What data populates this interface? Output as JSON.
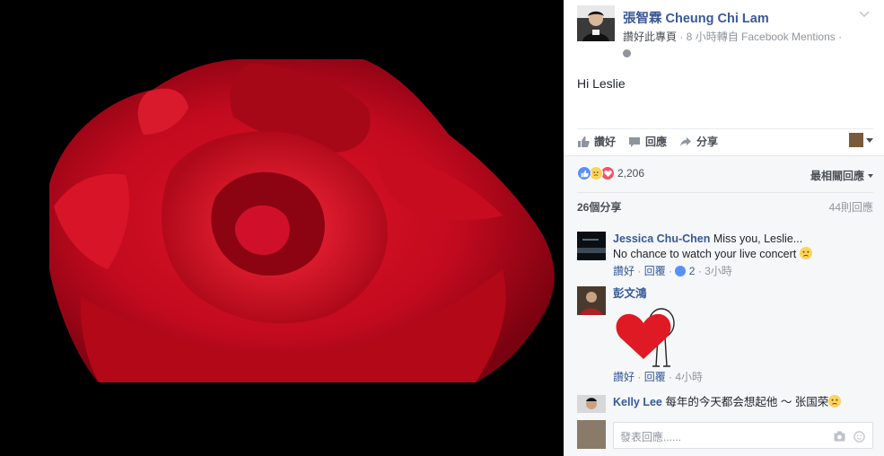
{
  "post": {
    "page_name": "張智霖 Cheung Chi Lam",
    "like_page": "讚好此專頁",
    "meta": " · 8 小時轉自 Facebook Mentions ·",
    "text": "Hi Leslie"
  },
  "actions": {
    "like": "讚好",
    "comment": "回應",
    "share": "分享"
  },
  "feedback": {
    "reaction_count": "2,206",
    "most_relevant": "最相關回應",
    "shares": "26個分享",
    "comments": "44則回應"
  },
  "comments": [
    {
      "author": "Jessica Chu-Chen",
      "text1": " Miss you, Leslie...",
      "text2": "No chance to watch your live concert ",
      "like": "讚好",
      "reply": "回覆",
      "likes": "2",
      "time": "3小時"
    },
    {
      "author": "彭文鴻",
      "like": "讚好",
      "reply": "回覆",
      "time": "4小時"
    },
    {
      "author": "Kelly Lee",
      "text": " 每年的今天都会想起他 ～ 张国荣"
    }
  ],
  "composer": {
    "placeholder": "發表回應......"
  },
  "colors": {
    "link": "#365899",
    "page_name": "#3b5998",
    "like": "#5890ff",
    "love": "#f25268",
    "sad": "#fcd35c"
  }
}
